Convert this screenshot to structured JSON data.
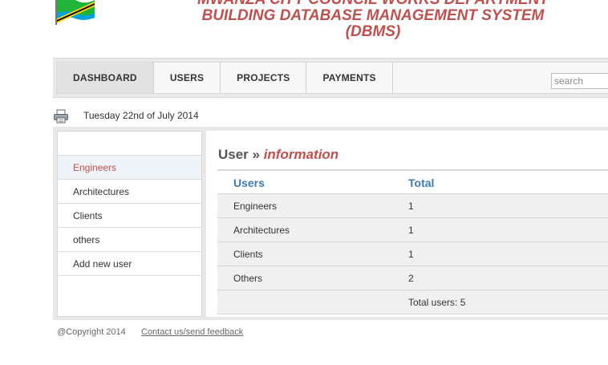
{
  "header": {
    "title_line1": "MWANZA CITY COUNCIL WORKS DEPARTMENT",
    "title_line2": "BUILDING DATABASE MANAGEMENT SYSTEM",
    "title_line3": "(DBMS)",
    "title_color": "#c0504d"
  },
  "nav": {
    "items": [
      {
        "label": "DASHBOARD"
      },
      {
        "label": "USERS"
      },
      {
        "label": "PROJECTS"
      },
      {
        "label": "PAYMENTS"
      }
    ],
    "search_placeholder": "search"
  },
  "toolbar": {
    "print_icon": "printer-icon",
    "date": "Tuesday 22nd of July 2014"
  },
  "sidebar": {
    "items": [
      {
        "label": "Engineers"
      },
      {
        "label": "Architectures"
      },
      {
        "label": "Clients"
      },
      {
        "label": "others"
      },
      {
        "label": "Add new user"
      }
    ]
  },
  "main": {
    "heading_prefix": "User » ",
    "heading_em": "information",
    "table": {
      "headers": [
        "Users",
        "Total"
      ],
      "rows": [
        [
          "Engineers",
          "1"
        ],
        [
          "Architectures",
          "1"
        ],
        [
          "Clients",
          "1"
        ],
        [
          "Others",
          "2"
        ]
      ],
      "total_label": "Total users: 5"
    }
  },
  "footer": {
    "copyright": "@Copyright 2014",
    "contact_link": "Contact us/send feedback"
  }
}
